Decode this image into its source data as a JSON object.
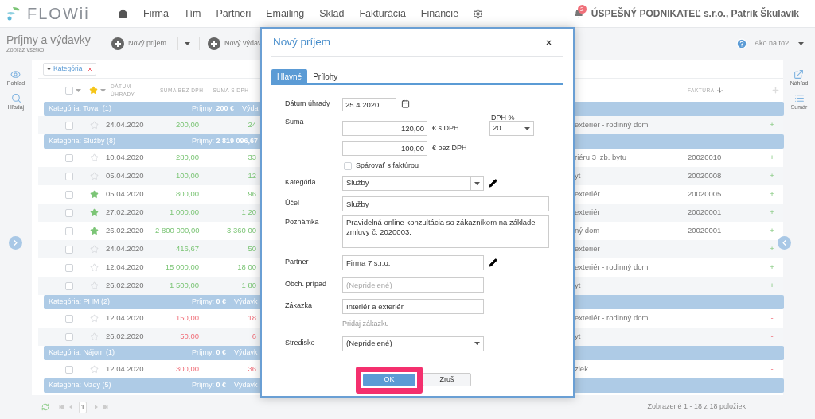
{
  "nav": {
    "logo": "FLOWii",
    "items": [
      "Firma",
      "Tím",
      "Partneri",
      "Emailing",
      "Sklad",
      "Fakturácia",
      "Financie"
    ],
    "notifications": "2",
    "account": "ÚSPEŠNÝ PODNIKATEĽ s.r.o., Patrik Škulavík"
  },
  "header": {
    "title": "Príjmy a výdavky",
    "subtitle": "Zobraz všetko",
    "buttons": [
      "Nový príjem",
      "Nový výdav"
    ],
    "help": "Ako na to?"
  },
  "left_rail": [
    "Pohľad",
    "Hľadaj"
  ],
  "right_rail": [
    "Náhľad",
    "Sumár"
  ],
  "filter_chip": "Kategória",
  "columns": {
    "select_all_checked": false,
    "date": "DÁTUM ÚHRADY",
    "net": "SUMA BEZ DPH",
    "gross": "SUMA S DPH",
    "invoice": "FAKTÚRA"
  },
  "groups": [
    {
      "label": "Kategória: Tovar (1)",
      "income_label": "Príjmy:",
      "income": "200 €",
      "expense_label": "Výda",
      "rows": [
        {
          "checked": false,
          "starred": false,
          "date": "24.04.2020",
          "net": "200,00",
          "gross": "24",
          "kind": "income",
          "project": "exteriér - rodinný dom",
          "sign": "+"
        }
      ]
    },
    {
      "label": "Kategória: Služby (8)",
      "income_label": "Príjmy:",
      "income": "2 819 096,67",
      "rows": [
        {
          "checked": false,
          "starred": false,
          "date": "10.04.2020",
          "net": "280,00",
          "gross": "33",
          "kind": "income",
          "project": "riéru 3 izb. bytu",
          "invoice": "20020010",
          "sign": "+"
        },
        {
          "checked": false,
          "starred": false,
          "date": "05.04.2020",
          "net": "100,00",
          "gross": "12",
          "kind": "income",
          "project": "yt",
          "invoice": "20020008",
          "sign": "+"
        },
        {
          "checked": false,
          "starred": true,
          "date": "05.04.2020",
          "net": "800,00",
          "gross": "96",
          "kind": "income",
          "project": "exteriér",
          "invoice": "20020005",
          "sign": "+"
        },
        {
          "checked": false,
          "starred": true,
          "date": "27.02.2020",
          "net": "1 000,00",
          "gross": "1 20",
          "kind": "income",
          "project": "exteriér",
          "invoice": "20020001",
          "sign": "+"
        },
        {
          "checked": false,
          "starred": true,
          "date": "26.02.2020",
          "net": "2 800 000,00",
          "gross": "3 360 00",
          "kind": "income",
          "project": "ný dom",
          "invoice": "20020001",
          "sign": "+"
        },
        {
          "checked": false,
          "starred": false,
          "date": "24.04.2020",
          "net": "416,67",
          "gross": "50",
          "kind": "income",
          "project": "exteriér",
          "sign": "+"
        },
        {
          "checked": false,
          "starred": false,
          "date": "12.04.2020",
          "net": "15 000,00",
          "gross": "18 00",
          "kind": "income",
          "project": "exteriér - rodinný dom",
          "sign": "+"
        },
        {
          "checked": false,
          "starred": false,
          "date": "26.02.2020",
          "net": "1 500,00",
          "gross": "1 80",
          "kind": "income",
          "project": "yt",
          "sign": "+"
        }
      ]
    },
    {
      "label": "Kategória: PHM (2)",
      "income_label": "Príjmy:",
      "income": "0 €",
      "expense_label": "Výdavk",
      "rows": [
        {
          "checked": false,
          "starred": false,
          "date": "12.04.2020",
          "net": "150,00",
          "gross": "18",
          "kind": "expense",
          "project": "exteriér - rodinný dom",
          "sign": "-"
        },
        {
          "checked": false,
          "starred": false,
          "date": "26.02.2020",
          "net": "50,00",
          "gross": "6",
          "kind": "expense",
          "project": "yt",
          "sign": "-"
        }
      ]
    },
    {
      "label": "Kategória: Nájom (1)",
      "income_label": "Príjmy:",
      "income": "0 €",
      "expense_label": "Výdavk",
      "rows": [
        {
          "checked": false,
          "starred": false,
          "date": "12.04.2020",
          "net": "300,00",
          "gross": "36",
          "kind": "expense",
          "project": "ziek",
          "sign": "-"
        }
      ]
    },
    {
      "label": "Kategória: Mzdy (5)",
      "income_label": "Príjmy:",
      "income": "0 €",
      "expense_label": "Výdavk"
    }
  ],
  "footer": {
    "page": "1",
    "status": "Zobrazené 1 - 18 z 18 položiek"
  },
  "dialog": {
    "title": "Nový príjem",
    "tabs": [
      {
        "label": "Hlavné",
        "selected": true
      },
      {
        "label": "Prílohy",
        "selected": false
      }
    ],
    "date": {
      "label": "Dátum úhrady",
      "value": "25.4.2020"
    },
    "sum": {
      "label": "Suma",
      "gross": "120,00",
      "gross_unit": "€ s DPH",
      "net": "100,00",
      "net_unit": "€ bez DPH"
    },
    "vat": {
      "label": "DPH %",
      "value": "20"
    },
    "pair": {
      "label": "Spárovať s faktúrou",
      "checked": false
    },
    "category": {
      "label": "Kategória",
      "value": "Služby"
    },
    "purpose": {
      "label": "Účel",
      "value": "Služby"
    },
    "note": {
      "label": "Poznámka",
      "value": "Pravidelná online konzultácia so zákazníkom na základe zmluvy č. 2020003."
    },
    "partner": {
      "label": "Partner",
      "value": "Firma 7 s.r.o."
    },
    "deal": {
      "label": "Obch. prípad",
      "placeholder": "(Nepridelené)"
    },
    "order": {
      "label": "Zákazka",
      "value": "Interiér a exteriér",
      "link": "Pridaj zákazku"
    },
    "center": {
      "label": "Stredisko",
      "value": "(Nepridelené)"
    },
    "ok": {
      "label": "OK",
      "highlighted": true
    },
    "cancel": "Zruš"
  }
}
